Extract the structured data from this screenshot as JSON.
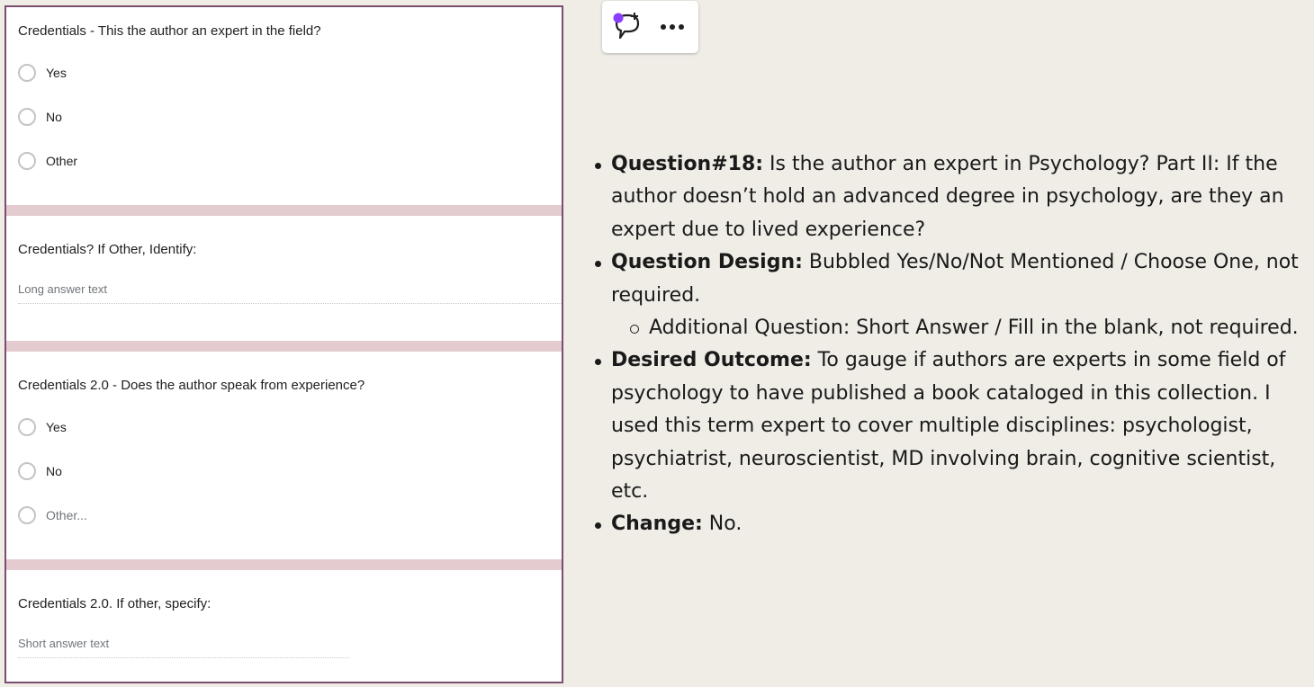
{
  "form": {
    "q1": {
      "title": "Credentials - This the author an expert in the field?",
      "options": [
        "Yes",
        "No",
        "Other"
      ]
    },
    "q2": {
      "title": "Credentials? If Other, Identify:",
      "placeholder": "Long answer text"
    },
    "q3": {
      "title": "Credentials 2.0 - Does the author speak from experience?",
      "options": [
        "Yes",
        "No",
        "Other..."
      ]
    },
    "q4": {
      "title": "Credentials 2.0. If other, specify:",
      "placeholder": "Short answer text"
    }
  },
  "toolbar": {
    "comment_icon": "add-comment-icon",
    "more_icon": "more-horizontal-icon",
    "accent_color": "#8a3ffc"
  },
  "notes": {
    "items": [
      {
        "label": "Question#18:",
        "text": " Is the author an expert in Psychology? Part II: If the author doesn’t hold an advanced degree in psychology, are they an expert due to lived experience?"
      },
      {
        "label": "Question Design:",
        "text": " Bubbled Yes/No/Not Mentioned / Choose One, not required.",
        "sub": [
          "Additional Question: Short Answer / Fill in the blank, not required."
        ]
      },
      {
        "label": "Desired Outcome:",
        "text": " To gauge if authors are experts in some field of psychology to have published a book cataloged in this collection. I used this term expert to cover multiple disciplines:  psychologist, psychiatrist, neuroscientist, MD involving brain, cognitive scientist, etc."
      },
      {
        "label": "Change:",
        "text": " No."
      }
    ]
  },
  "colors": {
    "page_bg": "#efede6",
    "panel_border": "#7b4e6f",
    "divider": "#e3cbd0"
  }
}
